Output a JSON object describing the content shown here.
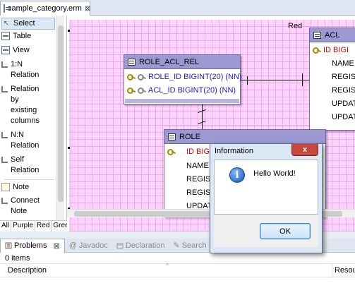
{
  "editor": {
    "tab_title": "sample_category.erm",
    "tab_close": "⊠"
  },
  "palette": {
    "items": [
      {
        "label": "Select",
        "icon": "cursor-icon"
      },
      {
        "label": "Table",
        "icon": "table-icon"
      },
      {
        "label": "View",
        "icon": "view-icon"
      },
      {
        "label": "1:N\nRelation",
        "icon": "relation-icon"
      },
      {
        "label": "Relation\nby\nexisting\ncolumns",
        "icon": "relation-existing-icon"
      },
      {
        "label": "N:N\nRelation",
        "icon": "nn-relation-icon"
      },
      {
        "label": "Self\nRelation",
        "icon": "self-relation-icon"
      },
      {
        "label": "Note",
        "icon": "note-icon"
      },
      {
        "label": "Connect\nNote",
        "icon": "connect-note-icon"
      }
    ],
    "filter_tabs": [
      "All",
      "Purple",
      "Red",
      "Green"
    ]
  },
  "canvas": {
    "category_label": "Red"
  },
  "tables": {
    "role_acl_rel": {
      "name": "ROLE_ACL_REL",
      "columns": [
        "ROLE_ID BIGINT(20) (NN)",
        "ACL_ID BIGINT(20) (NN)"
      ]
    },
    "acl": {
      "name": "ACL",
      "columns": [
        "ID BIGI",
        "NAME V",
        "REGIST",
        "REGIST",
        "UPDAT",
        "UPDAT"
      ]
    },
    "role": {
      "name": "ROLE",
      "columns": [
        "ID BIGI",
        "NAME V",
        "REGIST",
        "REGIST",
        "UPDATI"
      ]
    }
  },
  "bottom_panel": {
    "tabs": [
      {
        "label": "Problems",
        "active": true
      },
      {
        "label": "Javadoc",
        "active": false
      },
      {
        "label": "Declaration",
        "active": false
      },
      {
        "label": "Search",
        "active": false
      }
    ],
    "close_glyph": "⊠",
    "items_count": "0 items",
    "columns": [
      "Description",
      "Resou"
    ]
  },
  "dialog": {
    "title": "Information",
    "close": "x",
    "message": "Hello World!",
    "ok_label": "OK",
    "icon_glyph": "i"
  }
}
